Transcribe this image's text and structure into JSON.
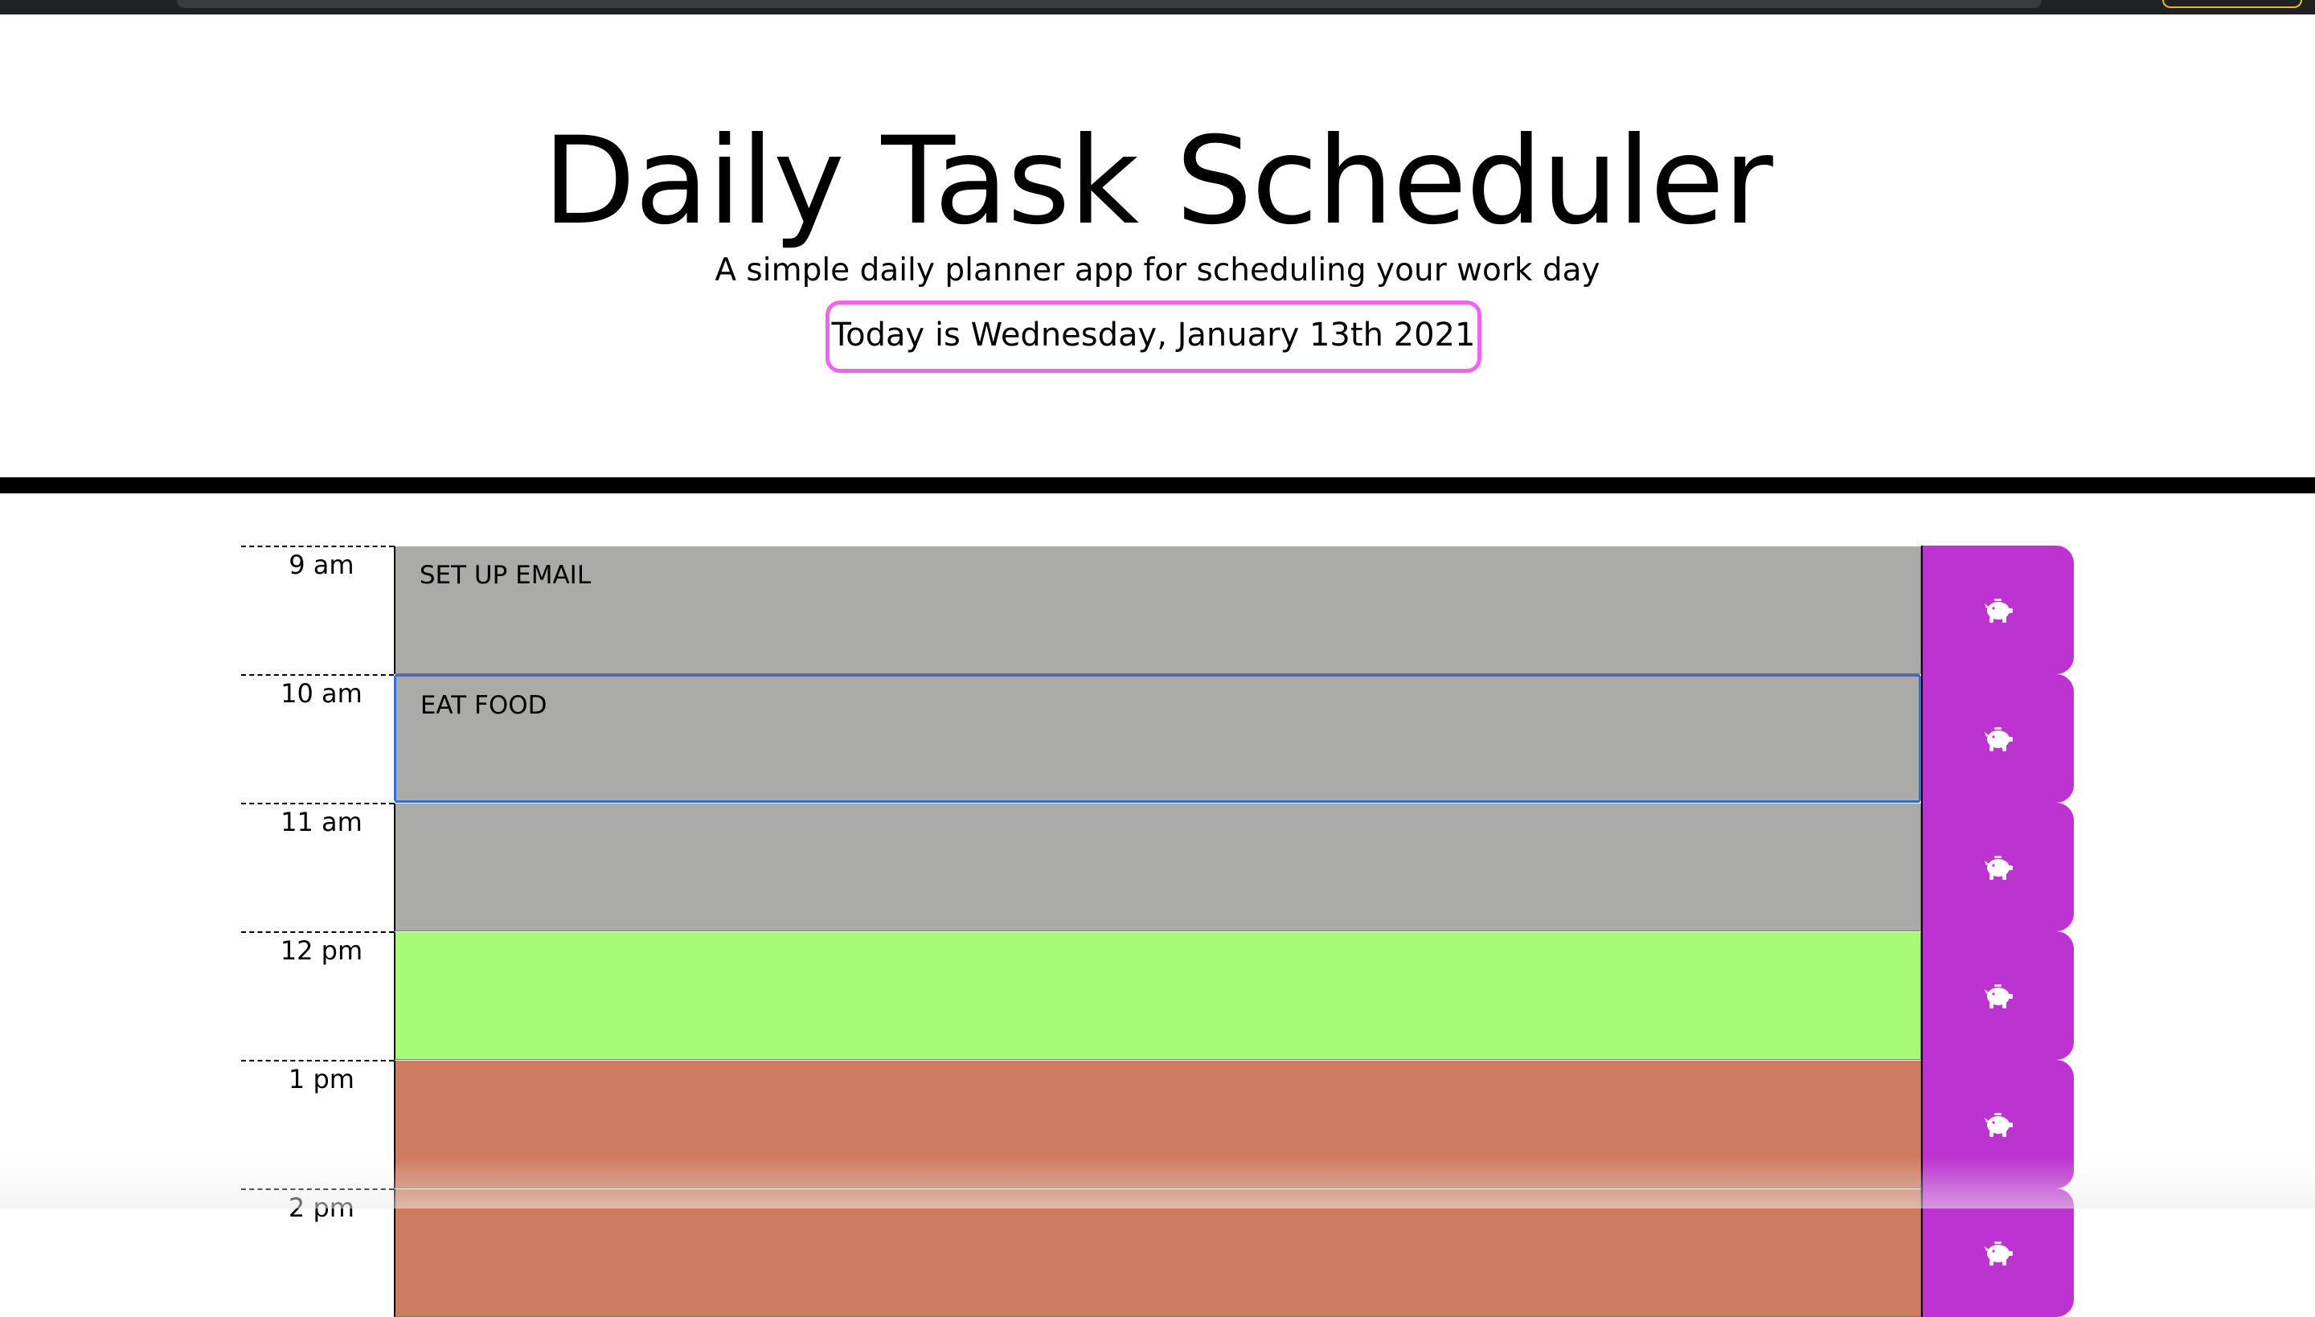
{
  "header": {
    "title": "Daily Task Scheduler",
    "subtitle": "A simple daily planner app for scheduling your work day",
    "current_day": "Today is Wednesday, January 13th 2021"
  },
  "colors": {
    "past": "#aaaaa8",
    "present": "#a8fb76",
    "future": "#ce7c60",
    "save_button": "#bd33d2",
    "current_day_border": "#f062f0"
  },
  "save_icon": "piggy-bank-icon",
  "time_blocks": [
    {
      "hour": "9 am",
      "task": "SET UP EMAIL",
      "status": "past"
    },
    {
      "hour": "10 am",
      "task": "EAT FOOD",
      "status": "past"
    },
    {
      "hour": "11 am",
      "task": "",
      "status": "past"
    },
    {
      "hour": "12 pm",
      "task": "",
      "status": "present"
    },
    {
      "hour": "1 pm",
      "task": "",
      "status": "future"
    },
    {
      "hour": "2 pm",
      "task": "",
      "status": "future"
    }
  ]
}
